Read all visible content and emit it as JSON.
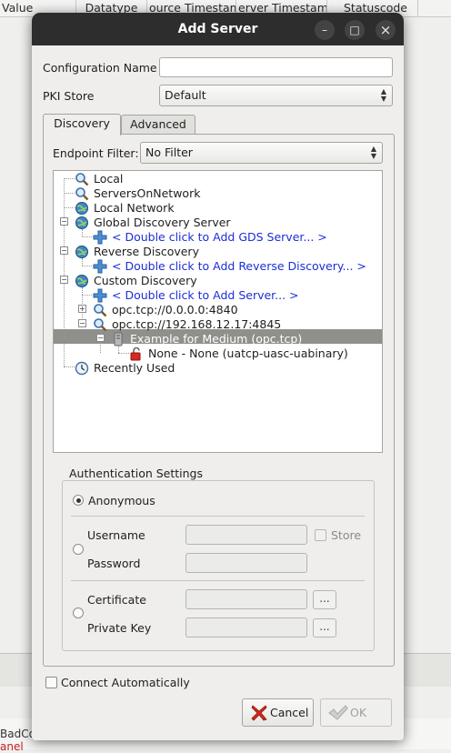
{
  "background": {
    "columns": [
      "Value",
      "Datatype",
      "ource Timestam",
      "erver Timestam",
      "Statuscode"
    ],
    "bottom_text_1": "BadCo",
    "bottom_text_2": "anel"
  },
  "dialog": {
    "title": "Add Server",
    "window_buttons": {
      "minimize": "–",
      "maximize": "□",
      "close": "×"
    },
    "config_name_label": "Configuration Name",
    "config_name_value": "",
    "pki_label": "PKI Store",
    "pki_value": "Default",
    "tabs": [
      {
        "label": "Discovery",
        "active": true
      },
      {
        "label": "Advanced",
        "active": false
      }
    ],
    "endpoint_filter_label": "Endpoint Filter:",
    "endpoint_filter_value": "No Filter",
    "tree": {
      "local": "Local",
      "servers_on_network": "ServersOnNetwork",
      "local_network": "Local Network",
      "gds": "Global Discovery Server",
      "gds_add": "< Double click to Add GDS Server... >",
      "reverse": "Reverse Discovery",
      "reverse_add": "< Double click to Add Reverse Discovery... >",
      "custom": "Custom Discovery",
      "custom_add": "< Double click to Add Server... >",
      "server1": "opc.tcp://0.0.0.0:4840",
      "server2": "opc.tcp://192.168.12.17:4845",
      "example": "Example for Medium (opc.tcp)",
      "endpoint": "None - None (uatcp-uasc-uabinary)",
      "recent": "Recently Used"
    },
    "auth": {
      "title": "Authentication Settings",
      "anonymous": "Anonymous",
      "username": "Username",
      "password": "Password",
      "store": "Store",
      "certificate": "Certificate",
      "private_key": "Private Key",
      "browse": "..."
    },
    "connect_auto": "Connect Automatically",
    "cancel": "Cancel",
    "ok": "OK"
  }
}
